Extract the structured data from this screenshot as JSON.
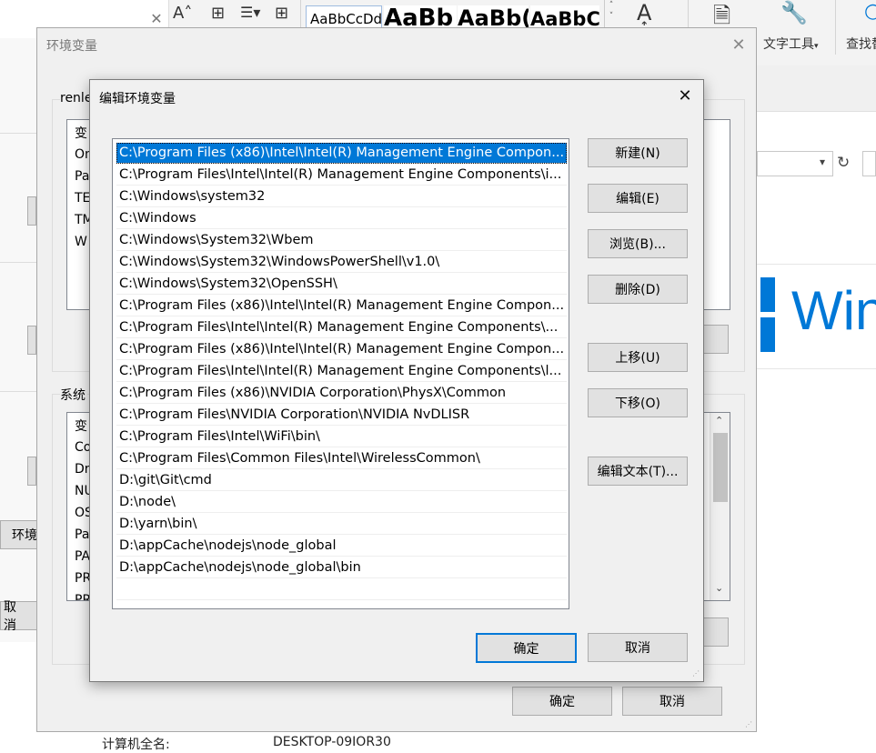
{
  "ribbon": {
    "styles": [
      "AaBbCcDd",
      "AaBb",
      "AaBb(",
      "AaBbC("
    ],
    "tools": [
      {
        "label": "文字工具",
        "arrow": "▾"
      },
      {
        "label": "查找替",
        "arrow": ""
      }
    ]
  },
  "bg_settings": {
    "windows_text": "Win",
    "computer_name_label": "计算机全名:",
    "computer_name_value": "DESKTOP-09IOR30"
  },
  "bg_left": {
    "env_button": "环境",
    "cancel_button": "取消"
  },
  "env_window": {
    "title": "环境变量",
    "user_section_label": "renle",
    "user_vars_header": "变",
    "user_vars": [
      "On",
      "Pa",
      "TE",
      "TM",
      "W"
    ],
    "system_section_label": "系统",
    "system_vars_header": "变",
    "system_vars": [
      "Co",
      "Dr",
      "NU",
      "OS",
      "Pa",
      "PA",
      "PR",
      "PR"
    ],
    "ok_button": "确定",
    "cancel_button": "取消"
  },
  "edit_dialog": {
    "title": "编辑环境变量",
    "paths": [
      "C:\\Program Files (x86)\\Intel\\Intel(R) Management Engine Compon...",
      "C:\\Program Files\\Intel\\Intel(R) Management Engine Components\\i...",
      "C:\\Windows\\system32",
      "C:\\Windows",
      "C:\\Windows\\System32\\Wbem",
      "C:\\Windows\\System32\\WindowsPowerShell\\v1.0\\",
      "C:\\Windows\\System32\\OpenSSH\\",
      "C:\\Program Files (x86)\\Intel\\Intel(R) Management Engine Compon...",
      "C:\\Program Files\\Intel\\Intel(R) Management Engine Components\\...",
      "C:\\Program Files (x86)\\Intel\\Intel(R) Management Engine Compon...",
      "C:\\Program Files\\Intel\\Intel(R) Management Engine Components\\l...",
      "C:\\Program Files (x86)\\NVIDIA Corporation\\PhysX\\Common",
      "C:\\Program Files\\NVIDIA Corporation\\NVIDIA NvDLISR",
      "C:\\Program Files\\Intel\\WiFi\\bin\\",
      "C:\\Program Files\\Common Files\\Intel\\WirelessCommon\\",
      "D:\\git\\Git\\cmd",
      "D:\\node\\",
      "D:\\yarn\\bin\\",
      "D:\\appCache\\nodejs\\node_global",
      "D:\\appCache\\nodejs\\node_global\\bin"
    ],
    "selected_index": 0,
    "buttons": {
      "new": "新建(N)",
      "edit": "编辑(E)",
      "browse": "浏览(B)...",
      "delete": "删除(D)",
      "move_up": "上移(U)",
      "move_down": "下移(O)",
      "edit_text": "编辑文本(T)...",
      "ok": "确定",
      "cancel": "取消"
    }
  },
  "colors": {
    "selection": "#0078d7",
    "dialog_bg": "#f0f0f0",
    "button_bg": "#e1e1e1",
    "windows_blue": "#0078d7"
  }
}
